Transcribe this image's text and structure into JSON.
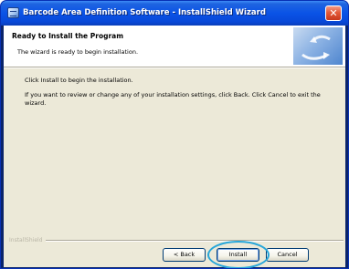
{
  "window": {
    "title": "Barcode Area Definition Software - InstallShield Wizard",
    "close_label": "✕"
  },
  "banner": {
    "title": "Ready to Install the Program",
    "subtitle": "The wizard is ready to begin installation."
  },
  "body": {
    "line1": "Click Install to begin the installation.",
    "line2": "If you want to review or change any of your installation settings, click Back. Click Cancel to exit the wizard."
  },
  "footer": {
    "brand": "InstallShield"
  },
  "buttons": {
    "back": "< Back",
    "install": "Install",
    "cancel": "Cancel"
  },
  "icons": {
    "app": "installer-icon",
    "banner": "installshield-graphic"
  },
  "colors": {
    "titlebar": "#0a53e6",
    "highlight": "#27a6d9",
    "dialog_bg": "#ece9d8"
  }
}
